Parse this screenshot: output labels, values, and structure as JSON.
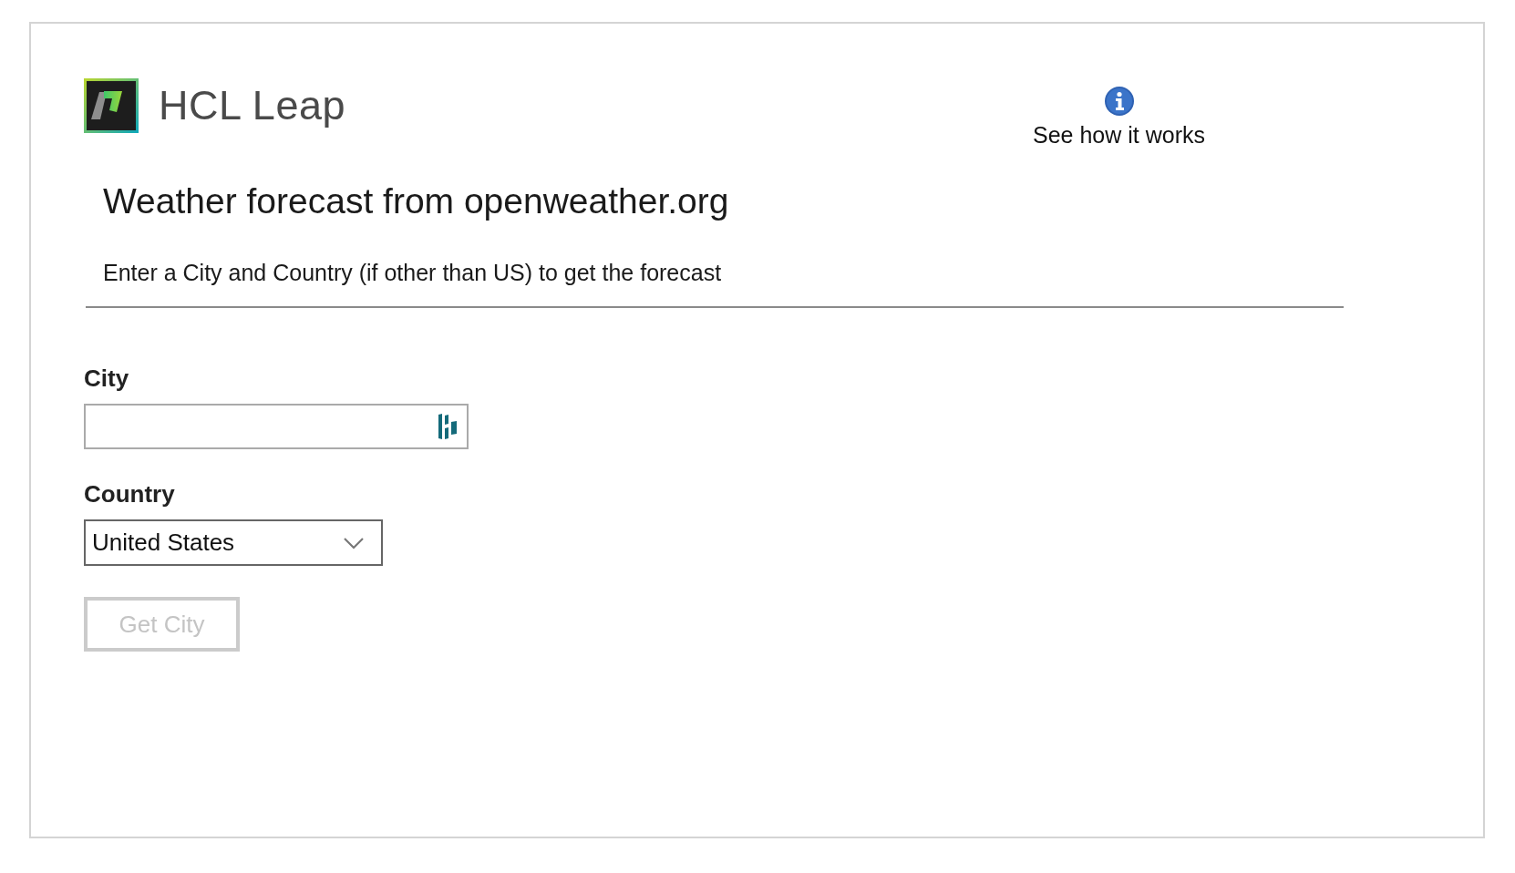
{
  "brand": {
    "name": "HCL Leap"
  },
  "help_link": {
    "label": "See how it works"
  },
  "title": "Weather forecast from openweather.org",
  "instructions": "Enter a City and Country (if other than US) to get the forecast",
  "fields": [
    {
      "kind": "text",
      "label": "City"
    },
    {
      "kind": "select",
      "label": "Country",
      "value": "United States"
    }
  ],
  "buttons": [
    {
      "label": "Get City",
      "disabled": true
    }
  ]
}
